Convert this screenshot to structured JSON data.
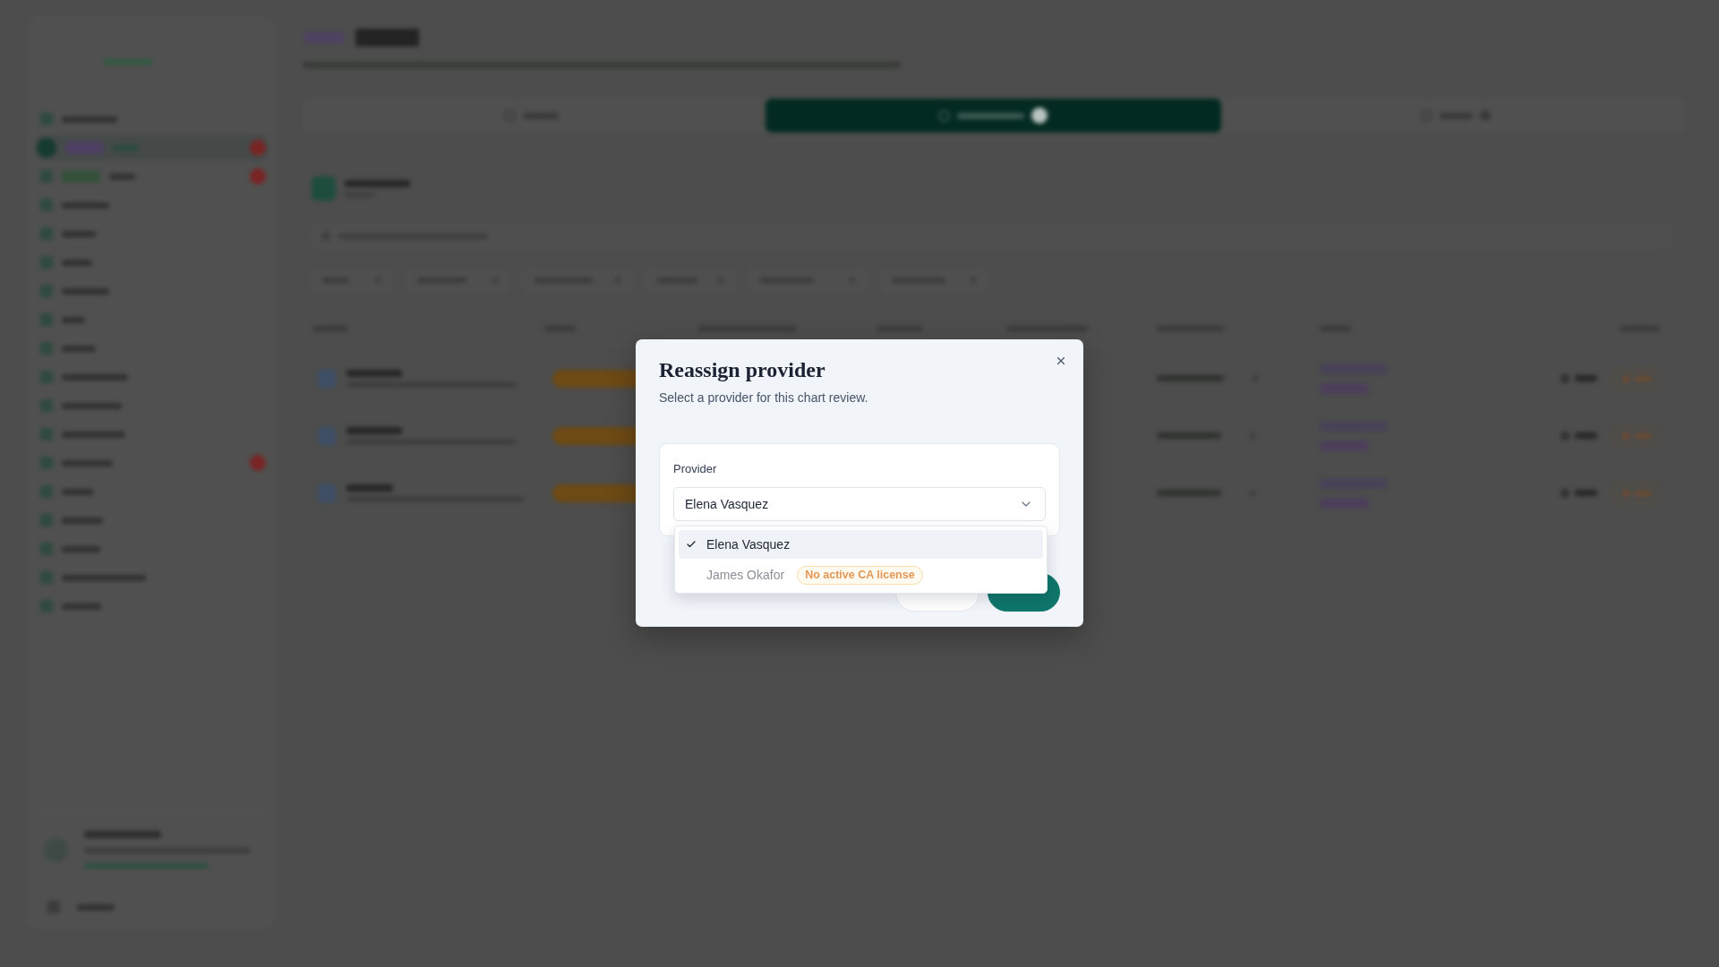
{
  "backdrop": {
    "sidebar_items": [
      {
        "selected": false,
        "alert": false
      },
      {
        "selected": true,
        "alert": true,
        "color": "#4d4062"
      },
      {
        "selected": false,
        "alert": true,
        "color": "#34503b"
      },
      {
        "selected": false,
        "alert": false
      },
      {
        "selected": false,
        "alert": false
      },
      {
        "selected": false,
        "alert": false
      },
      {
        "selected": false,
        "alert": false
      },
      {
        "selected": false,
        "alert": false
      },
      {
        "selected": false,
        "alert": false
      },
      {
        "selected": false,
        "alert": false
      },
      {
        "selected": false,
        "alert": false
      },
      {
        "selected": false,
        "alert": false
      },
      {
        "selected": false,
        "alert": true
      },
      {
        "selected": false,
        "alert": false
      },
      {
        "selected": false,
        "alert": false
      },
      {
        "selected": false,
        "alert": false
      },
      {
        "selected": false,
        "alert": false
      },
      {
        "selected": false,
        "alert": false
      }
    ],
    "tabs": [
      {
        "selected": false,
        "badge": false
      },
      {
        "selected": true,
        "badge": true
      },
      {
        "selected": false,
        "badge": true
      }
    ]
  },
  "dialog": {
    "title": "Reassign provider",
    "subtitle": "Select a provider for this chart review.",
    "field": {
      "label": "Provider",
      "value": "Elena Vasquez",
      "expanded": true
    },
    "options": [
      {
        "label": "Elena Vasquez",
        "selected": true,
        "disabled": false
      },
      {
        "label": "James Okafor",
        "selected": false,
        "disabled": true,
        "badge": "No active CA license"
      }
    ],
    "buttons": [
      {
        "kind": "secondary"
      },
      {
        "kind": "primary"
      }
    ]
  }
}
